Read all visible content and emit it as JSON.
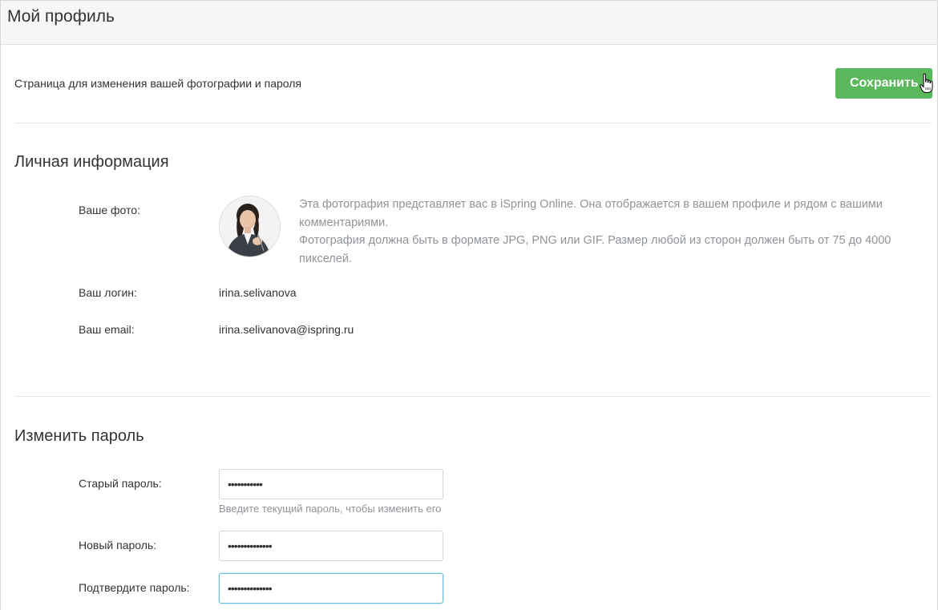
{
  "header": {
    "title": "Мой профиль"
  },
  "toolbar": {
    "subtitle": "Страница для изменения вашей фотографии и пароля",
    "save_label": "Сохранить"
  },
  "personal_info": {
    "title": "Личная информация",
    "photo_label": "Ваше фото:",
    "photo_description_line1": "Эта фотография представляет вас в iSpring Online. Она отображается в вашем профиле и рядом с вашими комментариями.",
    "photo_description_line2": "Фотография должна быть в формате JPG, PNG или GIF. Размер любой из сторон должен быть от 75 до 4000 пикселей.",
    "login_label": "Ваш логин:",
    "login_value": "irina.selivanova",
    "email_label": "Ваш email:",
    "email_value": "irina.selivanova@ispring.ru"
  },
  "change_password": {
    "title": "Изменить пароль",
    "old_label": "Старый пароль:",
    "old_value": "•••••••••••",
    "old_hint": "Введите текущий пароль, чтобы изменить его",
    "new_label": "Новый пароль:",
    "new_value": "••••••••••••••",
    "confirm_label": "Подтвердите пароль:",
    "confirm_value": "••••••••••••••"
  },
  "colors": {
    "accent_green": "#5cb85c",
    "focus_border": "#66bfd9",
    "muted_text": "#8f9499"
  }
}
